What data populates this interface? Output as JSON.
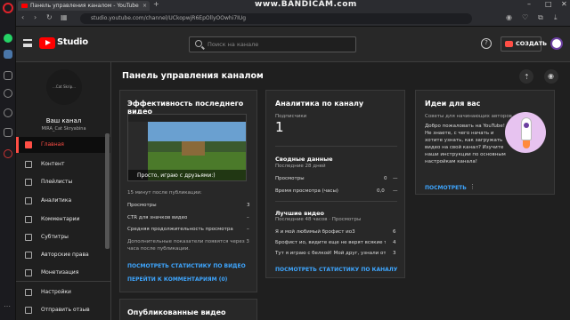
{
  "browser": {
    "tab_title": "Панель управления каналом - YouTube",
    "url": "studio.youtube.com/channel/UCkopwjR6EpOllyOOwhi7IUg",
    "recorder_watermark": "www.BANDICAM.com"
  },
  "header": {
    "logo_text": "Studio",
    "search_placeholder": "Поиск на канале",
    "help_glyph": "?",
    "create_label": "СОЗДАТЬ"
  },
  "sidebar": {
    "channel_avatar_text": "...Cat Skrip...",
    "channel_title": "Ваш канал",
    "channel_name": "MIRA_Cat Skryabina",
    "items": [
      {
        "label": "Главная",
        "icon": "home-icon",
        "active": true
      },
      {
        "label": "Контент",
        "icon": "content-icon"
      },
      {
        "label": "Плейлисты",
        "icon": "playlist-icon"
      },
      {
        "label": "Аналитика",
        "icon": "analytics-icon"
      },
      {
        "label": "Комментарии",
        "icon": "comments-icon"
      },
      {
        "label": "Субтитры",
        "icon": "subtitles-icon"
      },
      {
        "label": "Авторские права",
        "icon": "copyright-icon"
      },
      {
        "label": "Монетизация",
        "icon": "monetization-icon"
      },
      {
        "label": "Настройки",
        "icon": "gear-icon"
      },
      {
        "label": "Отправить отзыв",
        "icon": "feedback-icon"
      }
    ]
  },
  "main": {
    "title": "Панель управления каналом",
    "latest_video": {
      "title": "Эффективность последнего видео",
      "video_caption": "Просто, играю с друзьями:)",
      "since_text": "15 минут после публикации:",
      "rows": [
        {
          "label": "Просмотры",
          "value": "3"
        },
        {
          "label": "CTR для значков видео",
          "value": "–"
        },
        {
          "label": "Средняя продолжительность просмотра",
          "value": "–"
        }
      ],
      "note": "Дополнительные показатели появятся через 3 часа после публикации.",
      "link_stats": "ПОСМОТРЕТЬ СТАТИСТИКУ ПО ВИДЕО",
      "link_comments": "ПЕРЕЙТИ К КОММЕНТАРИЯМ (0)"
    },
    "published": {
      "title": "Опубликованные видео"
    },
    "analytics": {
      "title": "Аналитика по каналу",
      "subs_label": "Подписчики",
      "subs_value": "1",
      "summary_title": "Сводные данные",
      "summary_period": "Последние 28 дней",
      "summary_rows": [
        {
          "label": "Просмотры",
          "value": "0",
          "trend": "—"
        },
        {
          "label": "Время просмотра (часы)",
          "value": "0,0",
          "trend": "—"
        }
      ],
      "top_title": "Лучшие видео",
      "top_period": "Последние 48 часов · Просмотры",
      "top_rows": [
        {
          "label": "Я и мой любимый брофист ио3",
          "value": "6"
        },
        {
          "label": "Брофист ио, видите еще не верят всякие там!",
          "value": "4"
        },
        {
          "label": "Тут я играю с белкой! Мой друг, узнали откуда бел...",
          "value": "3"
        }
      ],
      "link": "ПОСМОТРЕТЬ СТАТИСТИКУ ПО КАНАЛУ"
    },
    "ideas": {
      "title": "Идеи для вас",
      "subtitle": "Советы для начинающих авторов",
      "body": "Добро пожаловать на YouTube! Не знаете, с чего начать и хотите узнать, как загружать видео на свой канал? Изучите наши инструкции по основным настройкам канала!",
      "link": "ПОСМОТРЕТЬ"
    }
  },
  "colors": {
    "accent": "#ff4e45",
    "link": "#3ea6ff",
    "youtube_red": "#ff0000"
  }
}
